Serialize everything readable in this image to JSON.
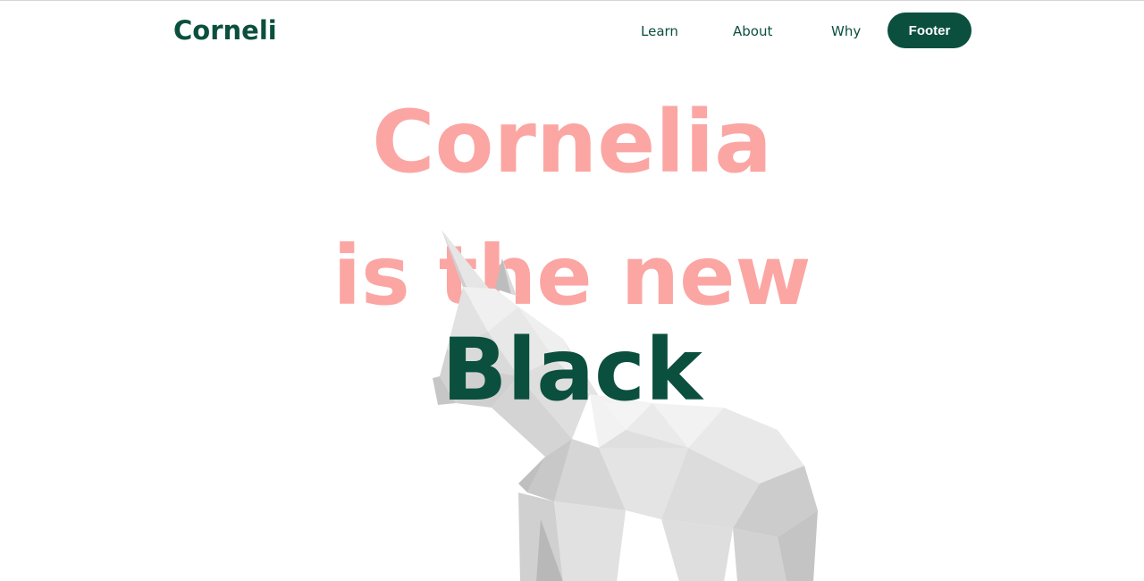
{
  "header": {
    "logo_text": "Corneli",
    "nav": {
      "learn": "Learn",
      "about": "About",
      "why": "Why",
      "footer_button": "Footer"
    }
  },
  "hero": {
    "line1": "Cornelia",
    "line2": "is the new",
    "line3": "Black"
  },
  "colors": {
    "brand_green": "#0b4f3e",
    "accent_pink": "#fba6a3"
  },
  "icons": {
    "hero_image": "unicorn-lowpoly-icon"
  }
}
